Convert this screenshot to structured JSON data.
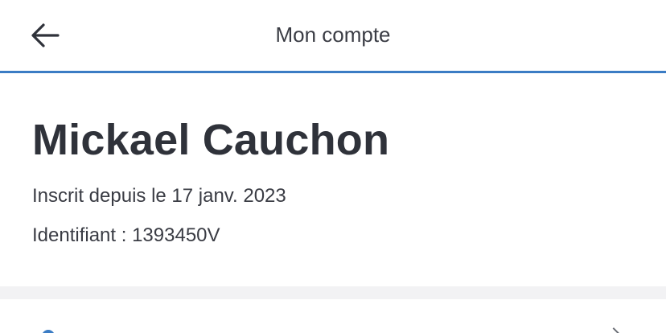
{
  "header": {
    "title": "Mon compte",
    "back_icon": "arrow-left-icon"
  },
  "profile": {
    "name": "Mickael Cauchon",
    "member_since": "Inscrit depuis le 17 janv. 2023",
    "identifier": "Identifiant : 1393450V"
  },
  "colors": {
    "accent": "#3b7cc4",
    "text": "#2f323a",
    "separator": "#f2f2f4"
  }
}
